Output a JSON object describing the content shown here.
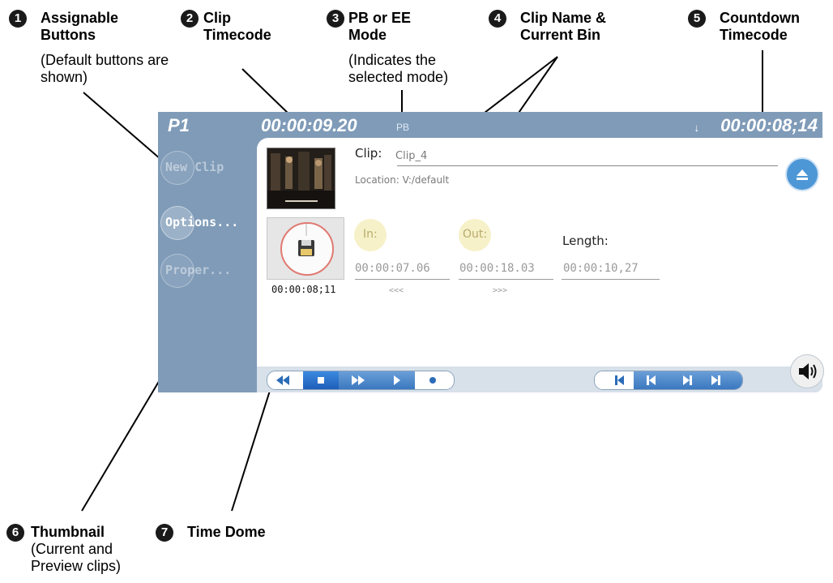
{
  "callouts": [
    {
      "num": "1",
      "title": "Assignable Buttons",
      "note": "(Default buttons are shown)"
    },
    {
      "num": "2",
      "title": "Clip Timecode",
      "note": ""
    },
    {
      "num": "3",
      "title": "PB or EE Mode",
      "note": "(Indicates the selected mode)"
    },
    {
      "num": "4",
      "title": "Clip Name & Current Bin",
      "note": ""
    },
    {
      "num": "5",
      "title": "Countdown Timecode",
      "note": ""
    },
    {
      "num": "6",
      "title": "Thumbnail",
      "note": "(Current and Preview clips)"
    },
    {
      "num": "7",
      "title": "Time Dome",
      "note": ""
    }
  ],
  "player": {
    "channel": "P1",
    "clip_timecode": "00:00:09.20",
    "mode": "PB",
    "countdown_timecode": "00:00:08;14",
    "buttons": [
      "New Clip",
      "Options...",
      "Proper..."
    ],
    "clip_label": "Clip:",
    "clip_name": "Clip_4",
    "location": "Location: V:/default",
    "time_dome": "00:00:08;11",
    "in_label": "In:",
    "out_label": "Out:",
    "length_label": "Length:",
    "in_tc": "00:00:07.06",
    "out_tc": "00:00:18.03",
    "length_tc": "00:00:10,27",
    "in_arrows": "<<<",
    "out_arrows": ">>>"
  },
  "icons": [
    "eject-icon",
    "save-icon",
    "rewind-icon",
    "stop-icon",
    "fast-forward-icon",
    "play-icon",
    "record-icon",
    "go-to-start-icon",
    "step-back-icon",
    "step-forward-icon",
    "go-to-end-icon",
    "speaker-icon"
  ],
  "colors": {
    "panel": "#7f9bb8",
    "accent": "#4e97d6",
    "dome_ring": "#e07a72",
    "inout": "#f6f1c8"
  }
}
